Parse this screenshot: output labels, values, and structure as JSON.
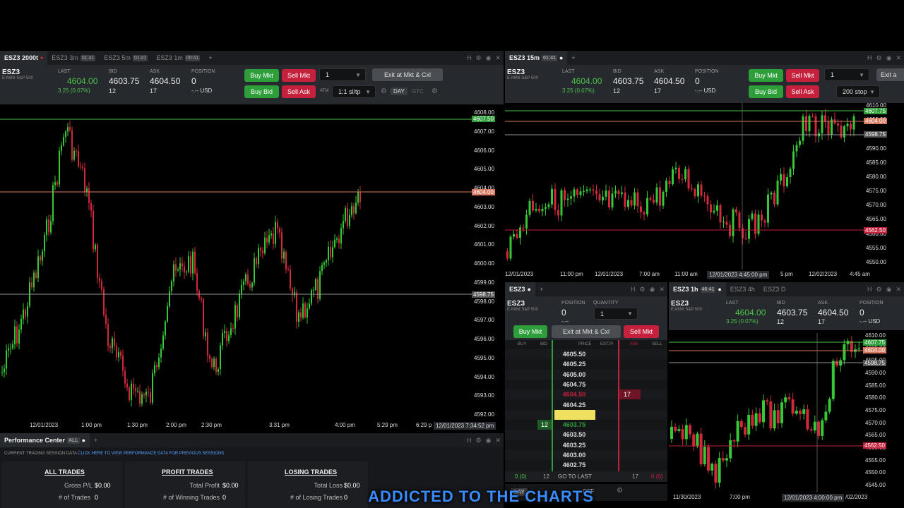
{
  "left": {
    "tabs": [
      {
        "label": "ESZ3 2000t",
        "badge": ""
      },
      {
        "label": "ESZ3 3m",
        "badge": "01:41"
      },
      {
        "label": "ESZ3 5m",
        "badge": "01:41"
      },
      {
        "label": "ESZ3 1m",
        "badge": "00:41"
      }
    ],
    "symbol": "ESZ3",
    "sub": "E-MINI S&P 500",
    "last_label": "LAST",
    "last": "4604.00",
    "change": "3.25 (0.07%)",
    "bid_label": "BID",
    "bid": "4603.75",
    "bid_size": "12",
    "ask_label": "ASK",
    "ask": "4604.50",
    "ask_size": "17",
    "pos_label": "POSITION",
    "pos": "0",
    "pos_usd": "-.-- USD",
    "buy_mkt": "Buy Mkt",
    "sell_mkt": "Sell Mkt",
    "buy_bid": "Buy Bid",
    "sell_ask": "Sell Ask",
    "qty": "1",
    "exit": "Exit at Mkt & Cxl",
    "atm_label": "ATM",
    "atm": "1:1 sl/tp",
    "day": "DAY",
    "gtc": "GTC",
    "price_ticks": [
      "4608.00",
      "4607.00",
      "4606.00",
      "4605.00",
      "4604.00",
      "4603.00",
      "4602.00",
      "4601.00",
      "4600.00",
      "4599.00",
      "4598.00",
      "4597.00",
      "4596.00",
      "4595.00",
      "4594.00",
      "4593.00",
      "4592.00"
    ],
    "tags": {
      "green": "4607.50",
      "red": "4604.00",
      "white": "4598.75"
    },
    "time_ticks": [
      "12/01/2023",
      "1:00 pm",
      "1:30 pm",
      "2:00 pm",
      "2:30 pm",
      "3:31 pm",
      "4:00 pm",
      "5:29 pm",
      "6:29 p"
    ],
    "crosshair": "12/01/2023 7:34:52 pm"
  },
  "tr": {
    "tab": "ESZ3 15m",
    "tab_badge": "01:41",
    "symbol": "ESZ3",
    "sub": "E-MINI S&P 500",
    "last": "4604.00",
    "change": "3.25 (0.07%)",
    "bid": "4603.75",
    "bid_size": "12",
    "ask": "4604.50",
    "ask_size": "17",
    "pos": "0",
    "pos_usd": "-.-- USD",
    "qty": "1",
    "stop": "200 stop",
    "exit": "Exit a",
    "price_ticks": [
      "4610.00",
      "4600.00",
      "4595.00",
      "4590.00",
      "4585.00",
      "4580.00",
      "4575.00",
      "4570.00",
      "4565.00",
      "4560.00",
      "4555.00",
      "4550.00"
    ],
    "tags": {
      "green": "4607.75",
      "red": "4604.00",
      "white": "4598.75",
      "red2": "4562.50"
    },
    "time_ticks": [
      "12/01/2023",
      "11:00 pm",
      "12/01/2023",
      "7:00 am",
      "11:00 am",
      "12/01/2023 4:45:00 pm",
      "5 pm",
      "12/02/2023",
      "4:45 am"
    ]
  },
  "dom": {
    "tab": "ESZ3",
    "symbol": "ESZ3",
    "sub": "E-MINI S&P 500",
    "pos_label": "POSITION",
    "pos": "0",
    "pos_sub": "-.--",
    "qty_label": "QUANTITY",
    "qty": "1",
    "buy_mkt": "Buy Mkt",
    "exit": "Exit at Mkt & Cxl",
    "sell_mkt": "Sell Mkt",
    "headers": [
      "BUY",
      "BID",
      "PRICE",
      "EST.P/",
      "ASK",
      "SELL"
    ],
    "rows": [
      {
        "price": "4605.50",
        "bid": "",
        "ask": ""
      },
      {
        "price": "4605.25",
        "bid": "",
        "ask": ""
      },
      {
        "price": "4605.00",
        "bid": "",
        "ask": ""
      },
      {
        "price": "4604.75",
        "bid": "",
        "ask": ""
      },
      {
        "price": "4604.50",
        "bid": "",
        "ask": "17"
      },
      {
        "price": "4604.25",
        "bid": "",
        "ask": ""
      },
      {
        "price": "4604.00",
        "bid": "",
        "ask": ""
      },
      {
        "price": "4603.75",
        "bid": "12",
        "ask": ""
      },
      {
        "price": "4603.50",
        "bid": "",
        "ask": ""
      },
      {
        "price": "4603.25",
        "bid": "",
        "ask": ""
      },
      {
        "price": "4603.00",
        "bid": "",
        "ask": ""
      },
      {
        "price": "4602.75",
        "bid": "",
        "ask": ""
      }
    ],
    "footer": {
      "buy": "0 (0)",
      "bid": "12",
      "goto": "GO TO LAST",
      "ask": "17",
      "sell": "0 (0)"
    },
    "day": "DAY",
    "off": "OFF"
  },
  "br": {
    "tabs": [
      {
        "label": "ESZ3 1h",
        "badge": "46:41"
      },
      {
        "label": "ESZ3 4h",
        "badge": ""
      },
      {
        "label": "ESZ3 D",
        "badge": ""
      }
    ],
    "symbol": "ESZ3",
    "sub": "E-MINI S&P 500",
    "last": "4604.00",
    "change": "3.25 (0.07%)",
    "bid": "4603.75",
    "bid_size": "12",
    "ask": "4604.50",
    "ask_size": "17",
    "pos": "0",
    "pos_usd": "-.-- USD",
    "price_ticks": [
      "4610.00",
      "4600.00",
      "4595.00",
      "4590.00",
      "4585.00",
      "4580.00",
      "4575.00",
      "4570.00",
      "4565.00",
      "4560.00",
      "4555.00",
      "4550.00",
      "4545.00"
    ],
    "tags": {
      "green": "4607.75",
      "red": "4604.00",
      "white": "4598.75",
      "red2": "4562.50"
    },
    "time_ticks": [
      "11/30/2023",
      "7:00 pm",
      "12/01/2023 4:00:00 pm",
      "/02/2023"
    ]
  },
  "perf": {
    "title": "Performance Center",
    "all": "ALL",
    "session": "CURRENT TRADING SESSION DATA",
    "link": "CLICK HERE TO VIEW PERFORMANCE DATA FOR PREVIOUS SESSIONS",
    "cols": [
      {
        "title": "ALL TRADES",
        "r1l": "Gross P/L",
        "r1v": "$0.00",
        "r2l": "# of Trades",
        "r2v": "0"
      },
      {
        "title": "PROFIT TRADES",
        "r1l": "Total Profit",
        "r1v": "$0.00",
        "r2l": "# of Winning Trades",
        "r2v": "0"
      },
      {
        "title": "LOSING TRADES",
        "r1l": "Total Loss",
        "r1v": "$0.00",
        "r2l": "# of Losing Trades",
        "r2v": "0"
      }
    ]
  },
  "banner": "ADDICTED TO THE CHARTS",
  "colors": {
    "green": "#4cc34c",
    "red": "#c5203c",
    "up": "#36c836",
    "down": "#d2283c"
  }
}
